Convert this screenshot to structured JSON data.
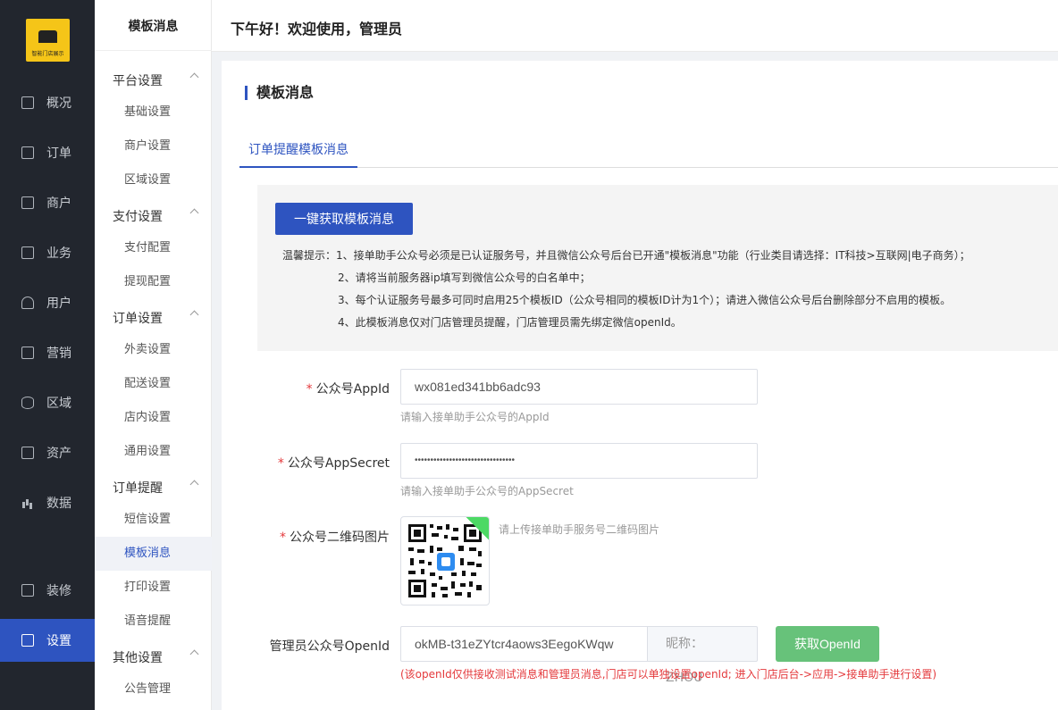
{
  "brand": {
    "logo_text": "智能门店展示"
  },
  "sidebar": {
    "items": [
      {
        "label": "概况",
        "icon": "dashboard-icon"
      },
      {
        "label": "订单",
        "icon": "order-icon"
      },
      {
        "label": "商户",
        "icon": "shop-icon"
      },
      {
        "label": "业务",
        "icon": "business-icon"
      },
      {
        "label": "用户",
        "icon": "user-icon"
      },
      {
        "label": "营销",
        "icon": "marketing-icon"
      },
      {
        "label": "区域",
        "icon": "database-icon"
      },
      {
        "label": "资产",
        "icon": "asset-icon"
      },
      {
        "label": "数据",
        "icon": "chart-icon"
      },
      {
        "label": "装修",
        "icon": "decorate-icon"
      },
      {
        "label": "设置",
        "icon": "settings-icon",
        "active": true
      }
    ]
  },
  "subnav": {
    "title": "模板消息",
    "groups": [
      {
        "label": "平台设置",
        "items": [
          "基础设置",
          "商户设置",
          "区域设置"
        ]
      },
      {
        "label": "支付设置",
        "items": [
          "支付配置",
          "提现配置"
        ]
      },
      {
        "label": "订单设置",
        "items": [
          "外卖设置",
          "配送设置",
          "店内设置",
          "通用设置"
        ]
      },
      {
        "label": "订单提醒",
        "items": [
          "短信设置",
          "模板消息",
          "打印设置",
          "语音提醒"
        ]
      },
      {
        "label": "其他设置",
        "items": [
          "公告管理"
        ]
      }
    ],
    "active_item": "模板消息"
  },
  "header": {
    "greeting": "下午好！欢迎使用，管理员"
  },
  "main": {
    "title": "模板消息",
    "tabs": [
      {
        "label": "订单提醒模板消息",
        "active": true
      }
    ],
    "fetch_button": "一键获取模板消息",
    "tips": [
      "温馨提示：1、接单助手公众号必须是已认证服务号，并且微信公众号后台已开通\"模板消息\"功能（行业类目请选择：IT科技>互联网|电子商务）；",
      "2、请将当前服务器ip填写到微信公众号的白名单中；",
      "3、每个认证服务号最多可同时启用25个模板ID（公众号相同的模板ID计为1个）；请进入微信公众号后台删除部分不启用的模板。",
      "4、此模板消息仅对门店管理员提醒，门店管理员需先绑定微信openId。"
    ],
    "form": {
      "appid": {
        "label": "公众号AppId",
        "value": "wx081ed341bb6adc93",
        "help": "请输入接单助手公众号的AppId"
      },
      "appsecret": {
        "label": "公众号AppSecret",
        "value": "••••••••••••••••••••••••••••••••",
        "help": "请输入接单助手公众号的AppSecret"
      },
      "qrcode": {
        "label": "公众号二维码图片",
        "help": "请上传接单助手服务号二维码图片"
      },
      "openid": {
        "label": "管理员公众号OpenId",
        "value": "okMB-t31eZYtcr4aows3EegoKWqw",
        "nickname": "昵称：ZHOU",
        "button": "获取OpenId",
        "warning": "(该openId仅供接收测试消息和管理员消息,门店可以单独设置openId; 进入门店后台->应用->接单助手进行设置)"
      }
    }
  },
  "colors": {
    "primary": "#2e54c0",
    "sidebar_bg": "#22262e",
    "success": "#67c27a",
    "danger": "#e4393c"
  }
}
